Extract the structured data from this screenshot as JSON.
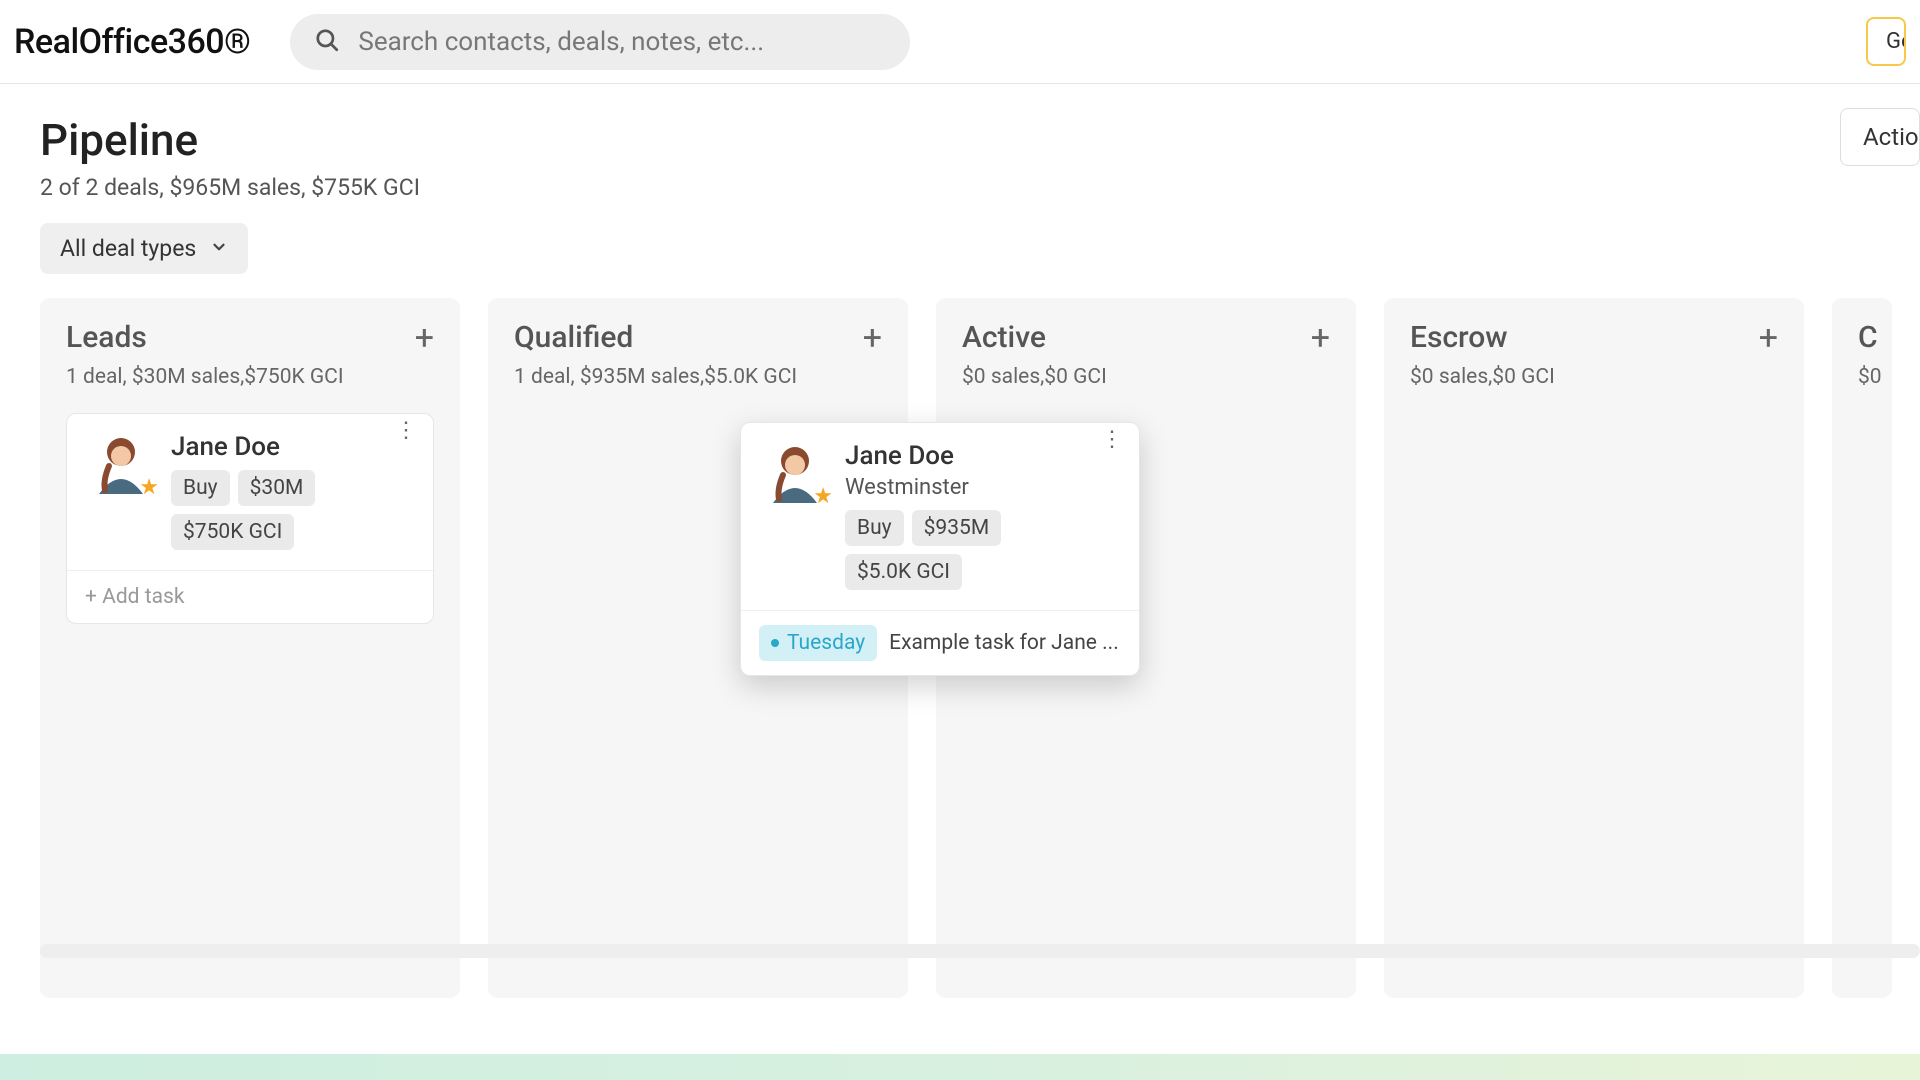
{
  "header": {
    "logo": "RealOffice360®",
    "search_placeholder": "Search contacts, deals, notes, etc...",
    "top_button_label": "Get started"
  },
  "page": {
    "title": "Pipeline",
    "subtitle": "2 of 2 deals, $965M sales, $755K GCI",
    "actions_label": "Actions",
    "filter_label": "All deal types"
  },
  "columns": {
    "leads": {
      "title": "Leads",
      "stats": "1 deal, $30M sales,$750K GCI"
    },
    "qualified": {
      "title": "Qualified",
      "stats": "1 deal, $935M sales,$5.0K GCI"
    },
    "active": {
      "title": "Active",
      "stats": "$0 sales,$0 GCI"
    },
    "escrow": {
      "title": "Escrow",
      "stats": "$0 sales,$0 GCI"
    },
    "closed": {
      "title": "C",
      "stats": "$0"
    }
  },
  "cards": {
    "lead1": {
      "name": "Jane Doe",
      "tags": {
        "type": "Buy",
        "amount": "$30M",
        "gci": "$750K GCI"
      },
      "add_task": "+ Add task"
    },
    "drag1": {
      "name": "Jane Doe",
      "subtitle": "Westminster",
      "tags": {
        "type": "Buy",
        "amount": "$935M",
        "gci": "$5.0K GCI"
      },
      "task_day": "Tuesday",
      "task_text": "Example task for Jane ..."
    }
  }
}
